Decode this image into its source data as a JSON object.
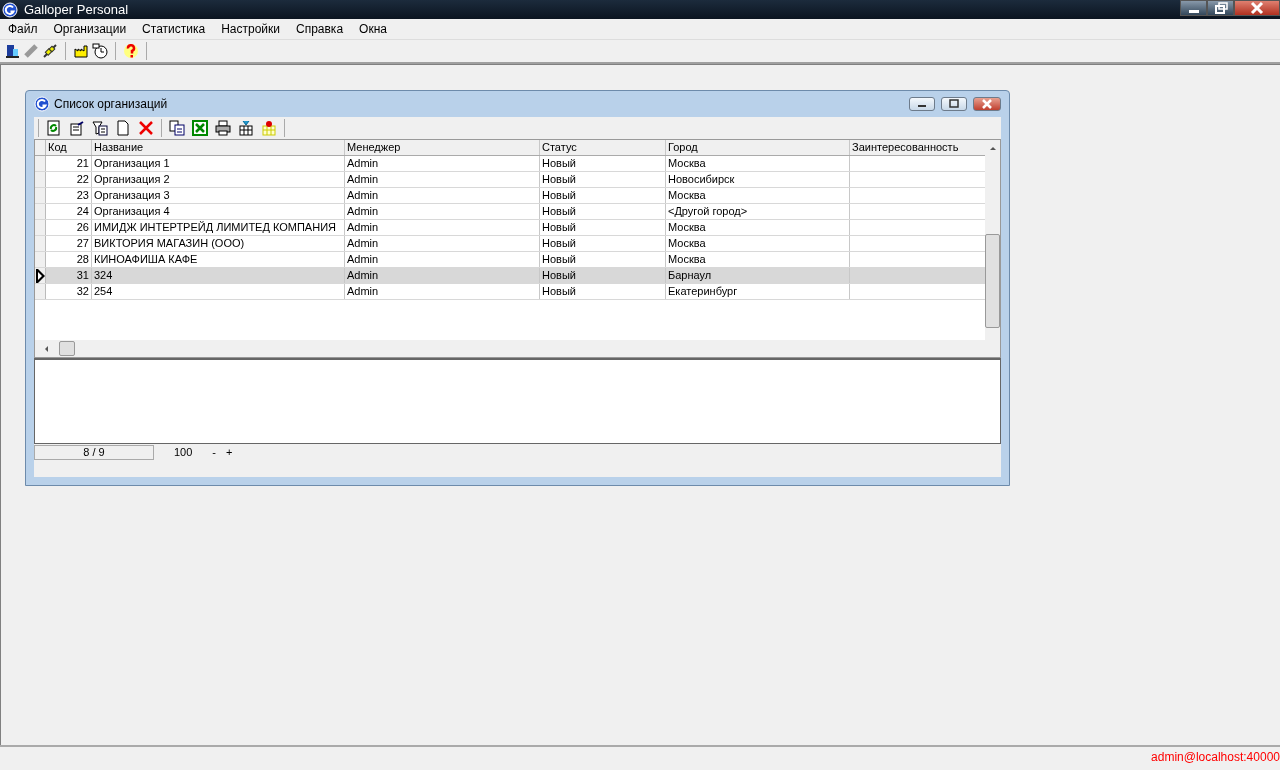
{
  "window": {
    "title": "Galloper Personal"
  },
  "menu": [
    "Файл",
    "Организации",
    "Статистика",
    "Настройки",
    "Справка",
    "Окна"
  ],
  "child_window": {
    "title": "Список организаций",
    "table": {
      "columns": [
        "Код",
        "Название",
        "Менеджер",
        "Статус",
        "Город",
        "Заинтересованность"
      ],
      "rows": [
        {
          "cells": [
            "21",
            "Организация 1",
            "Admin",
            "Новый",
            "Москва"
          ],
          "selected": false
        },
        {
          "cells": [
            "22",
            "Организация 2",
            "Admin",
            "Новый",
            "Новосибирск"
          ],
          "selected": false
        },
        {
          "cells": [
            "23",
            "Организация 3",
            "Admin",
            "Новый",
            "Москва"
          ],
          "selected": false
        },
        {
          "cells": [
            "24",
            "Организация 4",
            "Admin",
            "Новый",
            "<Другой город>"
          ],
          "selected": false
        },
        {
          "cells": [
            "26",
            "ИМИДЖ ИНТЕРТРЕЙД ЛИМИТЕД КОМПАНИЯ",
            "Admin",
            "Новый",
            "Москва"
          ],
          "selected": false
        },
        {
          "cells": [
            "27",
            "ВИКТОРИЯ МАГАЗИН (ООО)",
            "Admin",
            "Новый",
            "Москва"
          ],
          "selected": false
        },
        {
          "cells": [
            "28",
            "КИНОАФИША КАФЕ",
            "Admin",
            "Новый",
            "Москва"
          ],
          "selected": false
        },
        {
          "cells": [
            "31",
            "324",
            "Admin",
            "Новый",
            "Барнаул"
          ],
          "selected": true
        },
        {
          "cells": [
            "32",
            "254",
            "Admin",
            "Новый",
            "Екатеринбург"
          ],
          "selected": false
        }
      ]
    },
    "status": {
      "position": "8 / 9",
      "zoom": "100",
      "minus": "-",
      "plus": "+"
    }
  },
  "status_bar": {
    "user": "admin@localhost:40000"
  }
}
